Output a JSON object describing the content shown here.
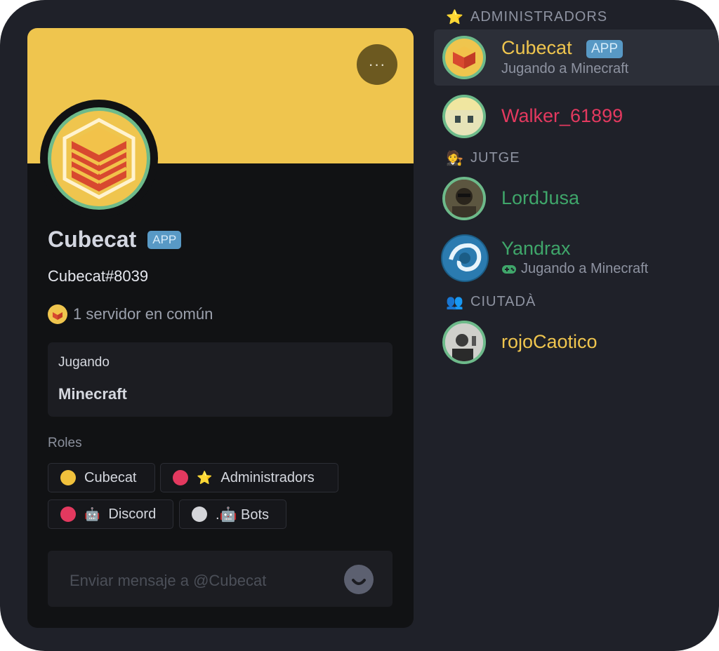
{
  "profile": {
    "more_label": "···",
    "username": "Cubecat",
    "app_badge": "APP",
    "tag": "Cubecat#8039",
    "mutual_servers": "1 servidor en común",
    "activity": {
      "label": "Jugando",
      "game": "Minecraft"
    },
    "roles_label": "Roles",
    "roles": [
      {
        "name": "Cubecat",
        "color": "#f0c13c",
        "emoji": ""
      },
      {
        "name": "Administradors",
        "color": "#e3395f",
        "emoji": "⭐"
      },
      {
        "name": "Discord",
        "color": "#e3395f",
        "emoji": "🤖"
      },
      {
        "name": ".🤖 Bots",
        "color": "#d4d5d9",
        "emoji": ""
      }
    ],
    "message_placeholder": "Enviar mensaje a @Cubecat",
    "banner_color": "#efc54e"
  },
  "members": {
    "sections": [
      {
        "title": "ADMINISTRADORS",
        "icon": "⭐"
      },
      {
        "title": "JUTGE",
        "icon": "🧑‍⚖️"
      },
      {
        "title": "CIUTADÀ",
        "icon": "👥"
      }
    ],
    "list": [
      {
        "name": "Cubecat",
        "color": "#efc54e",
        "badge": "APP",
        "status": "Jugando a Minecraft"
      },
      {
        "name": "Walker_61899",
        "color": "#e3395f"
      },
      {
        "name": "LordJusa",
        "color": "#3fa66a"
      },
      {
        "name": "Yandrax",
        "color": "#3fa66a",
        "status": "Jugando a Minecraft"
      },
      {
        "name": "rojoCaotico",
        "color": "#efc54e"
      }
    ]
  }
}
